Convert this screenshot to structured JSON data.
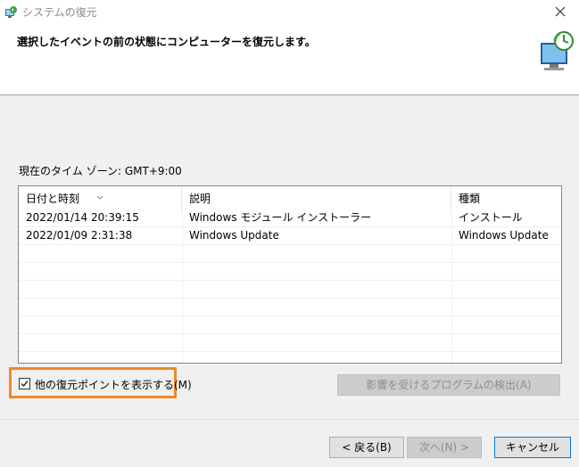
{
  "window": {
    "title": "システムの復元"
  },
  "header": {
    "title": "選択したイベントの前の状態にコンピューターを復元します。"
  },
  "timezone_label": "現在のタイム ゾーン: GMT+9:00",
  "table": {
    "columns": [
      "日付と時刻",
      "説明",
      "種類"
    ],
    "rows": [
      [
        "2022/01/14 20:39:15",
        "Windows モジュール インストーラー",
        "インストール"
      ],
      [
        "2022/01/09 2:31:38",
        "Windows Update",
        "Windows Update"
      ]
    ]
  },
  "show_more_checkbox": {
    "label": "他の復元ポイントを表示する(M)",
    "checked": true
  },
  "buttons": {
    "scan": "影響を受けるプログラムの検出(A)",
    "back": "< 戻る(B)",
    "next": "次へ(N) >",
    "cancel": "キャンセル"
  },
  "colors": {
    "highlight": "#f08a24",
    "accent": "#0078d7"
  }
}
